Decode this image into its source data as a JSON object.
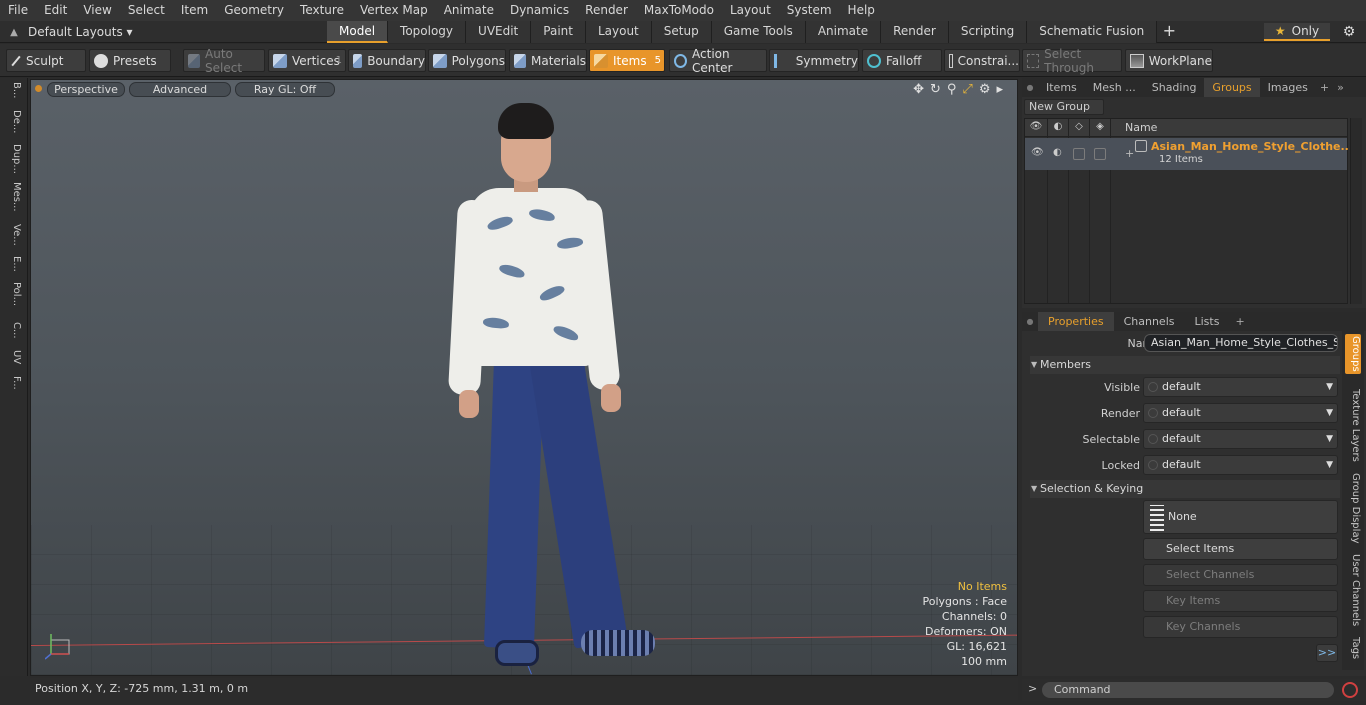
{
  "menu": [
    "File",
    "Edit",
    "View",
    "Select",
    "Item",
    "Geometry",
    "Texture",
    "Vertex Map",
    "Animate",
    "Dynamics",
    "Render",
    "MaxToModo",
    "Layout",
    "System",
    "Help"
  ],
  "layout": {
    "dropdown": "Default Layouts ▾",
    "tabs": [
      "Model",
      "Topology",
      "UVEdit",
      "Paint",
      "Layout",
      "Setup",
      "Game Tools",
      "Animate",
      "Render",
      "Scripting",
      "Schematic Fusion"
    ],
    "active_tab": "Model",
    "only_label": "Only"
  },
  "toolbar": {
    "sculpt": "Sculpt",
    "presets": "Presets",
    "auto_select": "Auto Select",
    "vertices": "Vertices",
    "vertices_count": "1",
    "boundary": "Boundary",
    "polygons": "Polygons",
    "materials": "Materials",
    "items": "Items",
    "items_count": "5",
    "action_center": "Action Center",
    "symmetry": "Symmetry",
    "falloff": "Falloff",
    "constraints": "Constrai...",
    "select_through": "Select Through",
    "workplane": "WorkPlane"
  },
  "left_strip": [
    "B...",
    "De...",
    "Dup...",
    "Mes...",
    "Ve...",
    "E...",
    "Pol...",
    "C...",
    "UV",
    "F..."
  ],
  "viewport": {
    "perspective": "Perspective",
    "advanced": "Advanced",
    "raygl": "Ray GL: Off",
    "info": {
      "no_items": "No Items",
      "polygons": "Polygons : Face",
      "channels": "Channels: 0",
      "deformers": "Deformers: ON",
      "gl": "GL: 16,621",
      "scale": "100 mm"
    }
  },
  "status": {
    "position": "Position X, Y, Z:   -725 mm, 1.31 m, 0 m"
  },
  "groups_panel": {
    "tabs": [
      "Items",
      "Mesh ...",
      "Shading",
      "Groups",
      "Images"
    ],
    "active_tab": "Groups",
    "new_group": "New Group",
    "name_header": "Name",
    "row_name": "Asian_Man_Home_Style_Clothe...",
    "row_count": "12 Items"
  },
  "properties_panel": {
    "tabs": [
      "Properties",
      "Channels",
      "Lists"
    ],
    "active_tab": "Properties",
    "name_label": "Name",
    "name_value": "Asian_Man_Home_Style_Clothes_Star",
    "members_section": "Members",
    "visible_label": "Visible",
    "visible_value": "default",
    "render_label": "Render",
    "render_value": "default",
    "selectable_label": "Selectable",
    "selectable_value": "default",
    "locked_label": "Locked",
    "locked_value": "default",
    "selection_section": "Selection & Keying",
    "none_btn": "None",
    "select_items": "Select Items",
    "select_channels": "Select Channels",
    "key_items": "Key Items",
    "key_channels": "Key Channels",
    "more": ">>"
  },
  "side_tabs": [
    "Groups",
    "Texture Layers",
    "Group Display",
    "User Channels",
    "Tags"
  ],
  "command": {
    "prompt": ">",
    "placeholder": "Command"
  }
}
